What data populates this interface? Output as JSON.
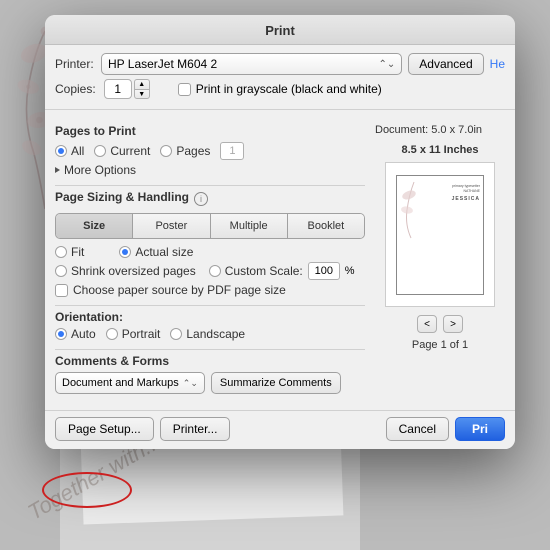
{
  "background": {
    "decoration_text": "Together with..."
  },
  "dialog": {
    "title": "Print",
    "printer_label": "Printer:",
    "printer_value": "HP LaserJet M604 2",
    "advanced_btn": "Advanced",
    "help_label": "He",
    "copies_label": "Copies:",
    "copies_value": "1",
    "grayscale_label": "Print in grayscale (black and white)",
    "pages_section": {
      "title": "Pages to Print",
      "all_label": "All",
      "current_label": "Current",
      "pages_label": "Pages",
      "pages_value": "1",
      "more_options_label": "More Options"
    },
    "sizing_section": {
      "title": "Page Sizing & Handling",
      "size_tab": "Size",
      "poster_tab": "Poster",
      "multiple_tab": "Multiple",
      "booklet_tab": "Booklet",
      "fit_label": "Fit",
      "actual_size_label": "Actual size",
      "shrink_label": "Shrink oversized pages",
      "custom_scale_label": "Custom Scale:",
      "custom_scale_value": "100",
      "custom_scale_unit": "%",
      "choose_source_label": "Choose paper source by PDF page size"
    },
    "orientation_section": {
      "title": "Orientation:",
      "auto_label": "Auto",
      "portrait_label": "Portrait",
      "landscape_label": "Landscape"
    },
    "comments_section": {
      "title": "Comments & Forms",
      "select_value": "Document and Markups",
      "summarize_btn": "Summarize Comments"
    },
    "bottom": {
      "page_setup_btn": "Page Setup...",
      "printer_btn": "Printer...",
      "cancel_btn": "Cancel",
      "print_btn": "Pri"
    },
    "preview": {
      "doc_info": "Document: 5.0 x 7.0in",
      "doc_size": "8.5 x 11 Inches",
      "page_info": "Page 1 of 1",
      "prev_btn": "<",
      "next_btn": ">"
    }
  }
}
